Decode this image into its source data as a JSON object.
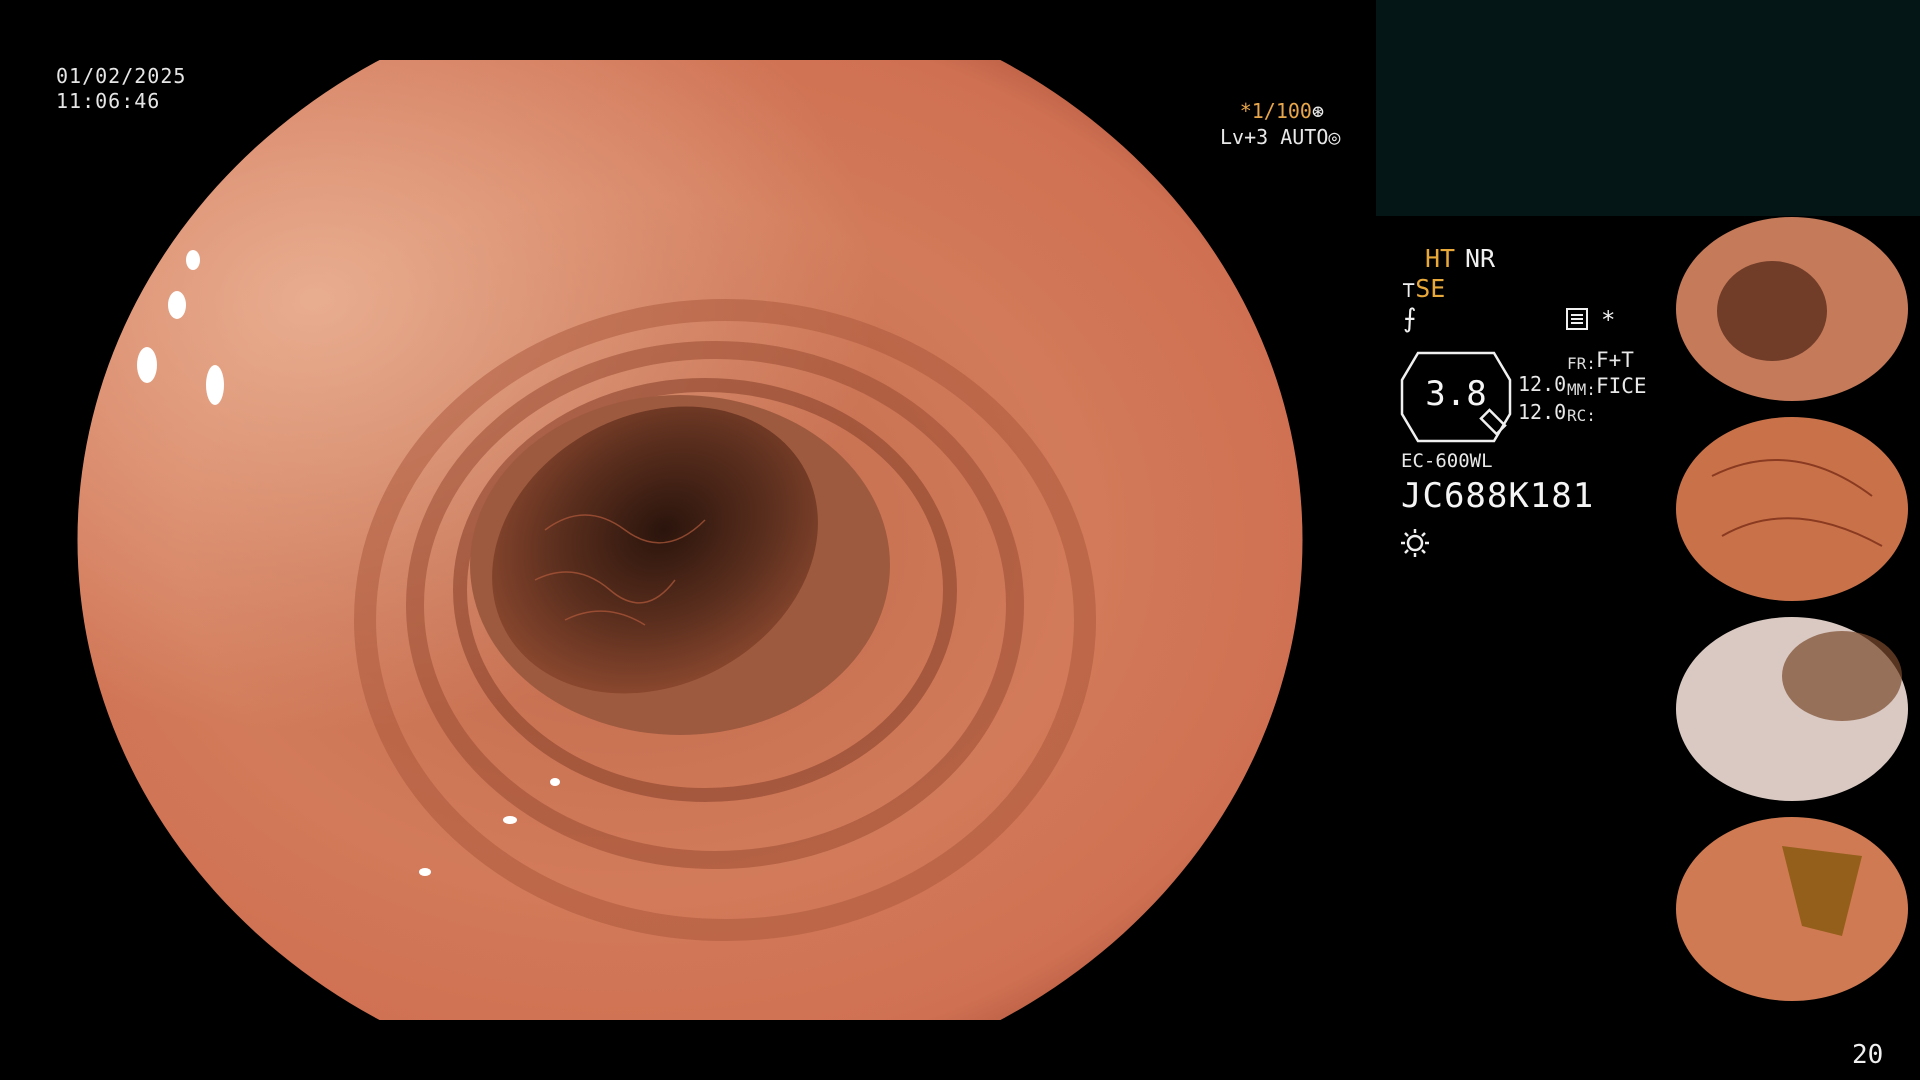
{
  "overlay": {
    "date": "01/02/2025",
    "time": "11:06:46",
    "shutter_prefix": "*",
    "shutter_value": "1/100",
    "level": "Lv+3 AUTO"
  },
  "panel": {
    "ht": "HT",
    "nr": "NR",
    "se": "SE",
    "star": "*",
    "gauge_value": "3.8",
    "mm_top": "12.0",
    "mm_bottom": "12.0",
    "fr_label": "FR:",
    "fr_value": "F+T",
    "mm_label": "MM:",
    "mm_value": "FICE",
    "rc_label": "RC:",
    "scope_model": "EC-600WL",
    "serial": "JC688K181"
  },
  "thumbnails": [
    {
      "name": "thumbnail-1",
      "base": "#c57a5a",
      "lumen": "#5b2e1c"
    },
    {
      "name": "thumbnail-2",
      "base": "#c9724a",
      "lumen": "#a3502e"
    },
    {
      "name": "thumbnail-3",
      "base": "#d9c9c2",
      "lumen": "#7a4a2e"
    },
    {
      "name": "thumbnail-4",
      "base": "#cf7a52",
      "lumen": "#8a5a12"
    }
  ],
  "page_number": "20",
  "colors": {
    "accent_orange": "#e8a83a",
    "panel_bg": "#041716",
    "tissue": "#d17a58"
  }
}
